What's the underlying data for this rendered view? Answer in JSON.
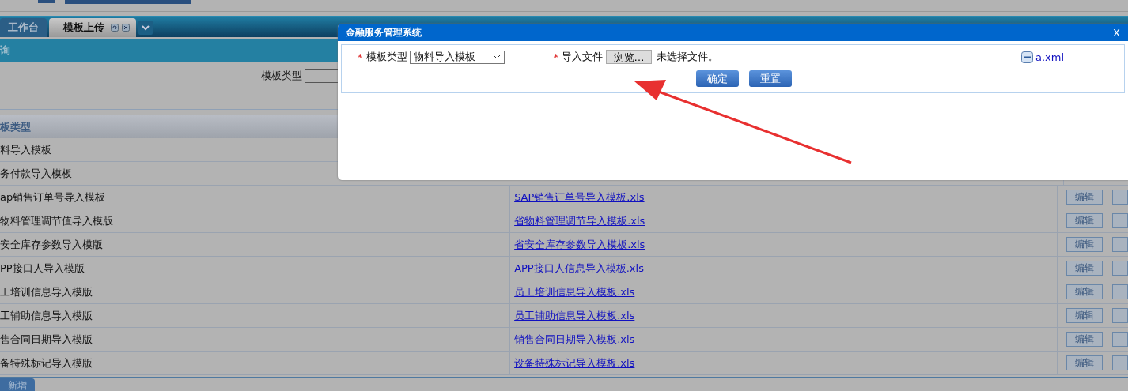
{
  "tabs": [
    {
      "label": "工作台",
      "selected": false,
      "closable": false
    },
    {
      "label": "模板上传",
      "selected": true,
      "closable": true
    }
  ],
  "query_panel": {
    "title": "询",
    "field_label": "模板类型"
  },
  "table": {
    "column_1": "板类型",
    "rows": [
      {
        "name": "料导入模板",
        "file": null,
        "action": null
      },
      {
        "name": "务付款导入模板",
        "file": null,
        "action": null
      },
      {
        "name": "ap销售订单号导入模板",
        "file": "SAP销售订单号导入模板.xls",
        "action": "编辑"
      },
      {
        "name": "物料管理调节值导入模版",
        "file": "省物料管理调节导入模板.xls",
        "action": "编辑"
      },
      {
        "name": "安全库存参数导入模版",
        "file": "省安全库存参数导入模板.xls",
        "action": "编辑"
      },
      {
        "name": "PP接口人导入模版",
        "file": "APP接口人信息导入模板.xls",
        "action": "编辑"
      },
      {
        "name": "工培训信息导入模版",
        "file": "员工培训信息导入模板.xls",
        "action": "编辑"
      },
      {
        "name": "工辅助信息导入模版",
        "file": "员工辅助信息导入模板.xls",
        "action": "编辑"
      },
      {
        "name": "售合同日期导入模版",
        "file": "销售合同日期导入模板.xls",
        "action": "编辑"
      },
      {
        "name": "备特殊标记导入模版",
        "file": "设备特殊标记导入模板.xls",
        "action": "编辑"
      }
    ]
  },
  "footer": {
    "add_button": "新增"
  },
  "dialog": {
    "title": "金融服务管理系统",
    "close": "X",
    "type_label": "模板类型",
    "type_value": "物料导入模板",
    "file_label": "导入文件",
    "browse": "浏览…",
    "no_file": "未选择文件。",
    "required_mark": "*",
    "attachment": "a.xml",
    "confirm": "确定",
    "reset": "重置"
  }
}
